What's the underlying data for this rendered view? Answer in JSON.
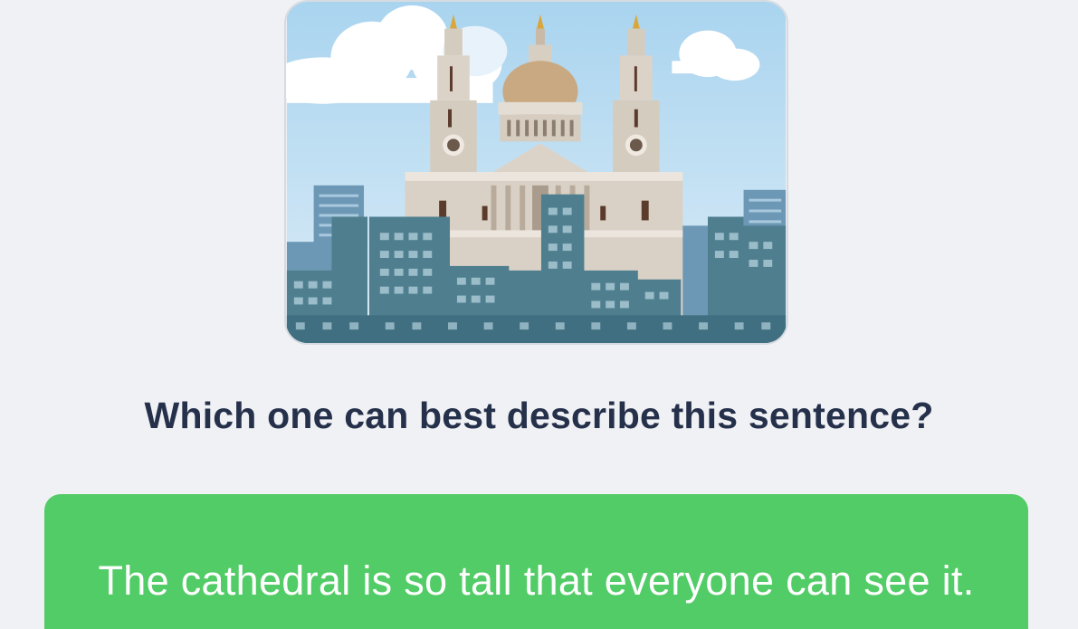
{
  "quiz": {
    "image_icon": "cathedral-illustration",
    "question": "Which one can best describe this sentence?",
    "options": [
      {
        "label": "The cathedral is so tall that everyone can see it.",
        "state": "selected-correct"
      }
    ]
  },
  "colors": {
    "background": "#f0f1f4",
    "question_text": "#25304a",
    "option_correct": "#52cc66",
    "option_text": "#ffffff"
  }
}
